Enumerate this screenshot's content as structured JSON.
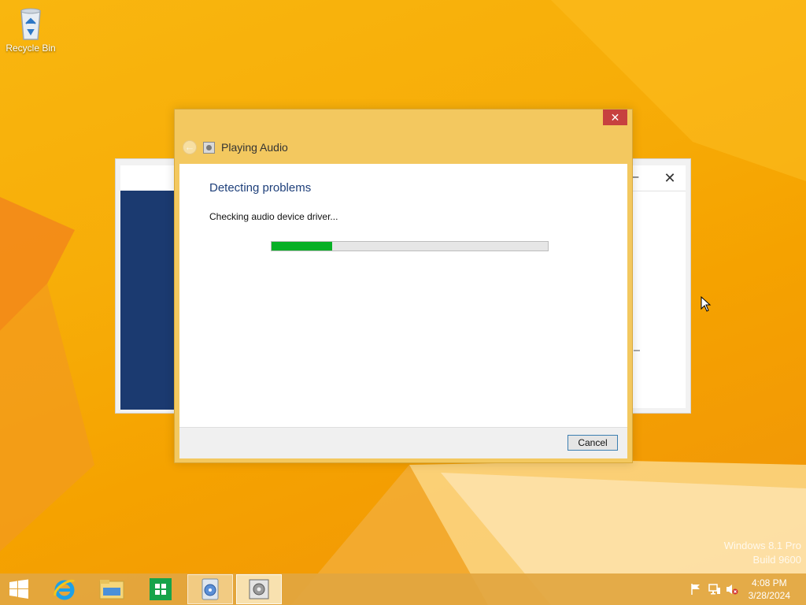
{
  "desktop": {
    "icons": [
      {
        "label": "Recycle Bin",
        "icon": "recycle-bin-icon"
      }
    ],
    "watermark": {
      "line1": "Windows 8.1 Pro",
      "line2": "Build 9600"
    }
  },
  "dialog": {
    "title": "Playing Audio",
    "close_glyph": "✕",
    "back_glyph": "←",
    "heading": "Detecting problems",
    "status": "Checking audio device driver...",
    "progress_fraction": 0.22,
    "cancel_label": "Cancel"
  },
  "background_window": {
    "close_glyph": "✕",
    "minimize_glyph": "–"
  },
  "taskbar": {
    "items": [
      {
        "name": "start-button",
        "icon": "windows-logo-icon"
      },
      {
        "name": "internet-explorer",
        "icon": "internet-explorer-icon"
      },
      {
        "name": "file-explorer",
        "icon": "folder-icon"
      },
      {
        "name": "store",
        "icon": "store-icon"
      },
      {
        "name": "media-center",
        "icon": "media-icon"
      },
      {
        "name": "troubleshooter",
        "icon": "troubleshooter-icon"
      }
    ],
    "tray": {
      "icons": [
        "flag-icon",
        "network-icon",
        "volume-muted-icon"
      ],
      "time": "4:08 PM",
      "date": "3/28/2024"
    }
  },
  "colors": {
    "accent": "#f3c85f",
    "close_red": "#c7413f",
    "progress_green": "#06b025",
    "heading_blue": "#1e3f7a"
  }
}
